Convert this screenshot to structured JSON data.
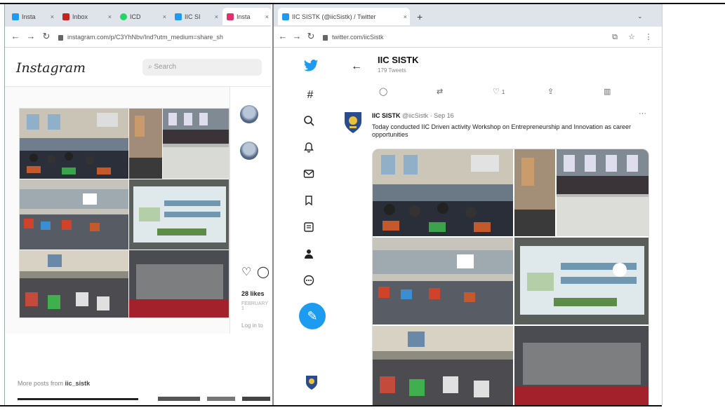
{
  "instagram_window": {
    "tabs": [
      {
        "label": "Insta",
        "icon": "twitter-icon",
        "color": "#1d9bf0"
      },
      {
        "label": "Inbox",
        "icon": "gmail-icon",
        "color": "#c5221f"
      },
      {
        "label": "ICD",
        "icon": "whatsapp-icon",
        "color": "#25d366"
      },
      {
        "label": "IIC SI",
        "icon": "twitter-icon",
        "color": "#1d9bf0"
      },
      {
        "label": "Insta",
        "icon": "instagram-icon",
        "color": "#e1306c"
      }
    ],
    "url": "instagram.com/p/C3YhNbv/Ind?utm_medium=share_sh",
    "logo": "Instagram",
    "search_placeholder": "Search",
    "likes": "28 likes",
    "likes_sub": "FEBRUARY 1",
    "login_prompt": "Log in to",
    "more_posts_prefix": "More posts from",
    "more_posts_account": "iic_sistk"
  },
  "twitter_window": {
    "tab_label": "IIC SISTK (@iicSistk) / Twitter",
    "url": "twitter.com/iicSistk",
    "profile_name": "IIC SISTK",
    "tweet_count": "179 Tweets",
    "tweet": {
      "author": "IIC SISTK",
      "handle": "@iicSistk · Sep 16",
      "text": "Today conducted IIC Driven activity Workshop on Entrepreneurship and Innovation as career opportunities",
      "like_count": "1"
    },
    "brand_color": "#1d9bf0"
  }
}
